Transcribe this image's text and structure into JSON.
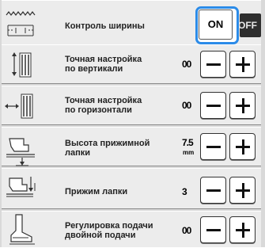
{
  "rows": [
    {
      "label": "Контроль ширины",
      "toggle_on": "ON",
      "toggle_off": "OFF",
      "toggle_state": "on",
      "icon": "width-control-icon"
    },
    {
      "label_line1": "Точная настройка",
      "label_line2": "по вертикали",
      "value": "00",
      "icon": "vertical-fine-adjust-icon"
    },
    {
      "label_line1": "Точная настройка",
      "label_line2": "по горизонтали",
      "value": "00",
      "icon": "horizontal-fine-adjust-icon"
    },
    {
      "label_line1": "Высота прижимной",
      "label_line2": "лапки",
      "value": "7.5",
      "unit": "mm",
      "icon": "presser-foot-height-icon"
    },
    {
      "label": "Прижим лапки",
      "value": "3",
      "icon": "presser-foot-pressure-icon"
    },
    {
      "label_line1": "Регулировка подачи",
      "label_line2": "двойной подачи",
      "value": "00",
      "icon": "dual-feed-adjust-icon"
    }
  ],
  "colors": {
    "accent": "#2b8be8",
    "panel": "#ececec",
    "off_button": "#2f2f2f"
  }
}
